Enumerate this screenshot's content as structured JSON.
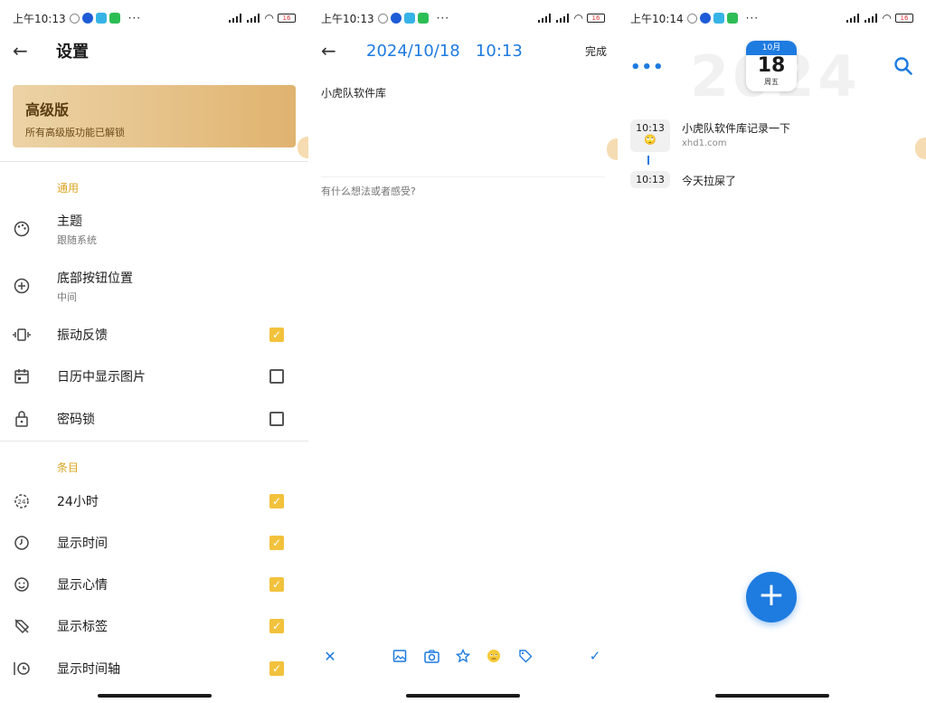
{
  "panels": {
    "settings": {
      "status_time": "上午10:13",
      "title": "设置",
      "premium": {
        "title": "高级版",
        "subtitle": "所有高级版功能已解锁"
      },
      "sections": [
        {
          "label": "通用",
          "rows": [
            {
              "label": "主题",
              "sub": "跟随系统",
              "icon": "palette-icon"
            },
            {
              "label": "底部按钮位置",
              "sub": "中间",
              "icon": "plus-circle-icon"
            },
            {
              "label": "振动反馈",
              "icon": "vibration-icon",
              "checked": true
            },
            {
              "label": "日历中显示图片",
              "icon": "calendar-icon",
              "checked": false
            },
            {
              "label": "密码锁",
              "icon": "lock-icon",
              "checked": false
            }
          ]
        },
        {
          "label": "条目",
          "rows": [
            {
              "label": "24小时",
              "icon": "24h-icon",
              "checked": true
            },
            {
              "label": "显示时间",
              "icon": "clock-icon",
              "checked": true
            },
            {
              "label": "显示心情",
              "icon": "smile-icon",
              "checked": true
            },
            {
              "label": "显示标签",
              "icon": "tag-off-icon",
              "checked": true
            },
            {
              "label": "显示时间轴",
              "icon": "timeline-icon",
              "checked": true
            }
          ]
        }
      ]
    },
    "editor": {
      "status_time": "上午10:13",
      "date": "2024/10/18",
      "time": "10:13",
      "done_label": "完成",
      "note_title": "小虎队软件库",
      "input_placeholder": "有什么想法或者感受?"
    },
    "timeline": {
      "status_time": "上午10:14",
      "year": "2024",
      "calendar": {
        "month": "10月",
        "day": "18",
        "weekday": "周五"
      },
      "entries": [
        {
          "time": "10:13",
          "mood": "🙄",
          "text": "小虎队软件库记录一下",
          "sub": "xhd1.com"
        },
        {
          "time": "10:13",
          "text": "今天拉屎了"
        }
      ],
      "fab_label": "+"
    }
  },
  "colors": {
    "accent": "#1e7be0",
    "gold": "#f2c23c",
    "section": "#d9a420"
  }
}
